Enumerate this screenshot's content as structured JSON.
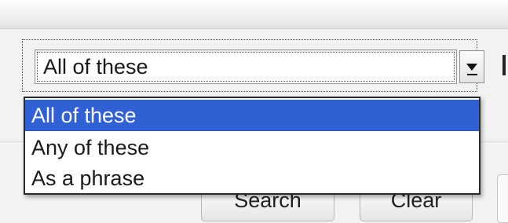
{
  "search_mode_select": {
    "selected_value": "All of these",
    "options": [
      {
        "label": "All of these",
        "selected": true
      },
      {
        "label": "Any of these",
        "selected": false
      },
      {
        "label": "As a phrase",
        "selected": false
      }
    ],
    "arrow_icon": "chevron-down-icon"
  },
  "buttons": {
    "search_label": "Search",
    "clear_label": "Clear"
  },
  "colors": {
    "highlight": "#2f61d4",
    "highlight_text": "#ffffff"
  }
}
